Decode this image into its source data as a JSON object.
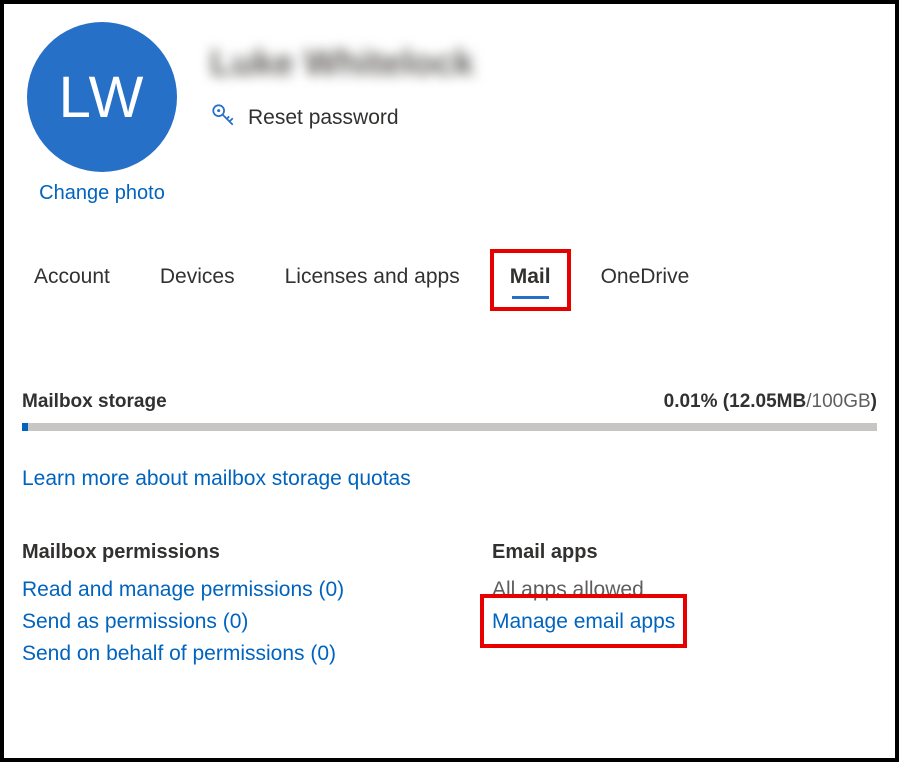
{
  "profile": {
    "initials": "LW",
    "display_name": "Luke Whitelock",
    "change_photo": "Change photo",
    "reset_password": "Reset password"
  },
  "tabs": [
    {
      "label": "Account",
      "active": false
    },
    {
      "label": "Devices",
      "active": false
    },
    {
      "label": "Licenses and apps",
      "active": false
    },
    {
      "label": "Mail",
      "active": true
    },
    {
      "label": "OneDrive",
      "active": false
    }
  ],
  "storage": {
    "title": "Mailbox storage",
    "percent": "0.01%",
    "used": "12.05MB",
    "total": "100GB",
    "learn_more": "Learn more about mailbox storage quotas"
  },
  "permissions": {
    "title": "Mailbox permissions",
    "read_manage": "Read and manage permissions (0)",
    "send_as": "Send as permissions (0)",
    "send_on_behalf": "Send on behalf of permissions (0)"
  },
  "email_apps": {
    "title": "Email apps",
    "status": "All apps allowed",
    "manage": "Manage email apps"
  }
}
